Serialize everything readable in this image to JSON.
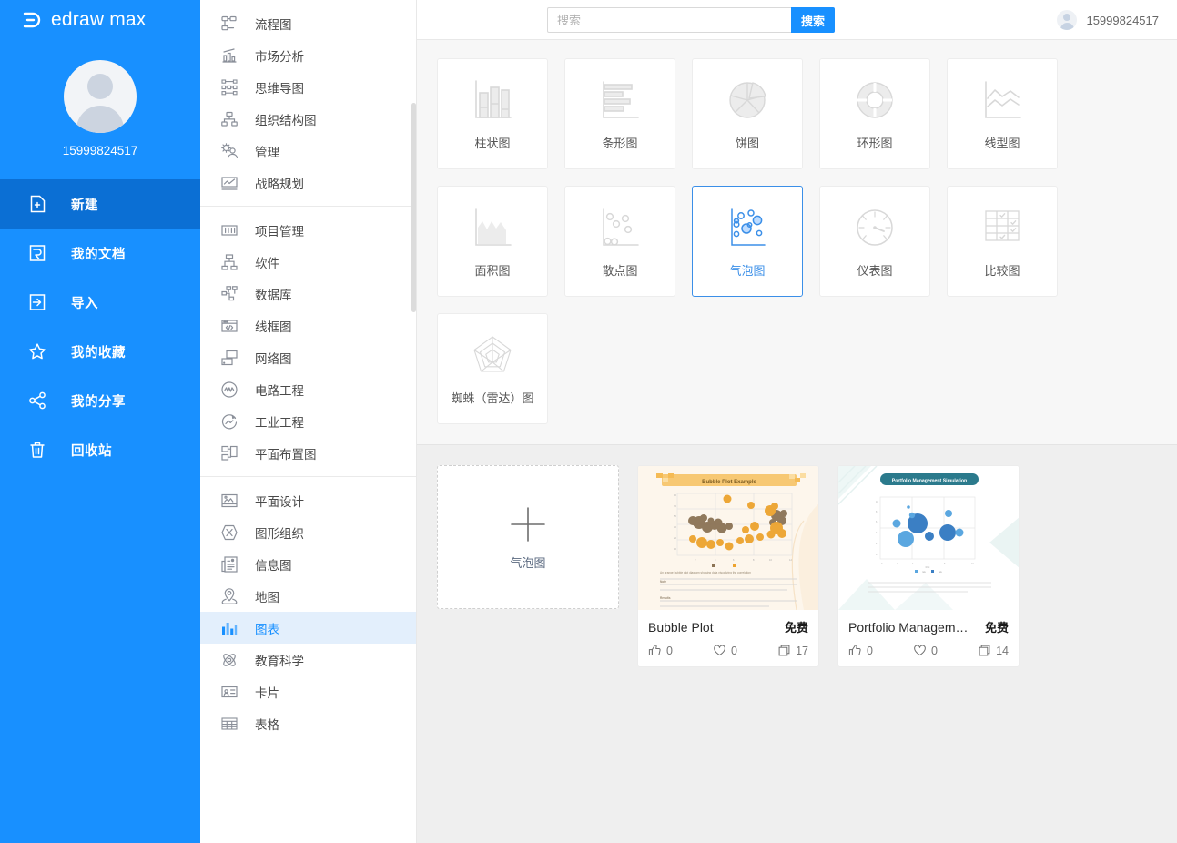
{
  "brand": {
    "name": "edraw max",
    "logo_icon": "edraw-logo-icon"
  },
  "sidebar": {
    "user": {
      "name": "15999824517",
      "avatar_icon": "user-avatar-icon"
    },
    "items": [
      {
        "label": "新建",
        "icon": "new-file-icon",
        "active": true
      },
      {
        "label": "我的文档",
        "icon": "documents-icon",
        "active": false
      },
      {
        "label": "导入",
        "icon": "import-icon",
        "active": false
      },
      {
        "label": "我的收藏",
        "icon": "star-icon",
        "active": false
      },
      {
        "label": "我的分享",
        "icon": "share-icon",
        "active": false
      },
      {
        "label": "回收站",
        "icon": "trash-icon",
        "active": false
      }
    ]
  },
  "categories": {
    "groups": [
      {
        "items": [
          {
            "label": "流程图",
            "icon": "flowchart-icon"
          },
          {
            "label": "市场分析",
            "icon": "market-analysis-icon"
          },
          {
            "label": "思维导图",
            "icon": "mindmap-icon"
          },
          {
            "label": "组织结构图",
            "icon": "org-chart-icon"
          },
          {
            "label": "管理",
            "icon": "management-icon"
          },
          {
            "label": "战略规划",
            "icon": "strategy-icon"
          }
        ]
      },
      {
        "items": [
          {
            "label": "项目管理",
            "icon": "project-management-icon"
          },
          {
            "label": "软件",
            "icon": "software-icon"
          },
          {
            "label": "数据库",
            "icon": "database-icon"
          },
          {
            "label": "线框图",
            "icon": "wireframe-icon"
          },
          {
            "label": "网络图",
            "icon": "network-icon"
          },
          {
            "label": "电路工程",
            "icon": "circuit-icon"
          },
          {
            "label": "工业工程",
            "icon": "industrial-icon"
          },
          {
            "label": "平面布置图",
            "icon": "floorplan-icon"
          }
        ]
      },
      {
        "items": [
          {
            "label": "平面设计",
            "icon": "graphic-design-icon"
          },
          {
            "label": "图形组织",
            "icon": "graphic-organizer-icon"
          },
          {
            "label": "信息图",
            "icon": "infographic-icon"
          },
          {
            "label": "地图",
            "icon": "map-icon"
          },
          {
            "label": "图表",
            "icon": "chart-icon",
            "active": true
          },
          {
            "label": "教育科学",
            "icon": "science-icon"
          },
          {
            "label": "卡片",
            "icon": "card-icon"
          },
          {
            "label": "表格",
            "icon": "table-icon"
          }
        ]
      }
    ]
  },
  "topbar": {
    "search": {
      "value": "",
      "placeholder": "搜索",
      "button_label": "搜索",
      "icon": "search-icon"
    },
    "user": {
      "name": "15999824517",
      "avatar_icon": "user-avatar-icon"
    }
  },
  "chart_types": [
    {
      "label": "柱状图",
      "icon": "column-chart-icon",
      "selected": false
    },
    {
      "label": "条形图",
      "icon": "bar-chart-icon",
      "selected": false
    },
    {
      "label": "饼图",
      "icon": "pie-chart-icon",
      "selected": false
    },
    {
      "label": "环形图",
      "icon": "donut-chart-icon",
      "selected": false
    },
    {
      "label": "线型图",
      "icon": "line-chart-icon",
      "selected": false
    },
    {
      "label": "面积图",
      "icon": "area-chart-icon",
      "selected": false
    },
    {
      "label": "散点图",
      "icon": "scatter-chart-icon",
      "selected": false
    },
    {
      "label": "气泡图",
      "icon": "bubble-chart-icon",
      "selected": true
    },
    {
      "label": "仪表图",
      "icon": "gauge-chart-icon",
      "selected": false
    },
    {
      "label": "比较图",
      "icon": "comparison-chart-icon",
      "selected": false
    },
    {
      "label": "蜘蛛（雷达）图",
      "icon": "radar-chart-icon",
      "selected": false
    }
  ],
  "templates": {
    "new_label": "气泡图",
    "new_icon": "plus-icon",
    "items": [
      {
        "title": "Bubble Plot",
        "price": "免费",
        "likes": "0",
        "favorites": "0",
        "copies": "17",
        "thumb_title": "Bubble Plot Example",
        "thumb_theme": "orange"
      },
      {
        "title": "Portfolio Managemen...",
        "price": "免费",
        "likes": "0",
        "favorites": "0",
        "copies": "14",
        "thumb_title": "Portfolio Management Simulation",
        "thumb_theme": "blue"
      }
    ],
    "stat_icons": {
      "like": "thumbs-up-icon",
      "favorite": "heart-icon",
      "copy": "copy-icon"
    }
  },
  "colors": {
    "brand": "#1890ff",
    "brand_dark": "#0b6fd4",
    "accent": "#3b8fe8",
    "panel_bg": "#f7f7f7"
  }
}
